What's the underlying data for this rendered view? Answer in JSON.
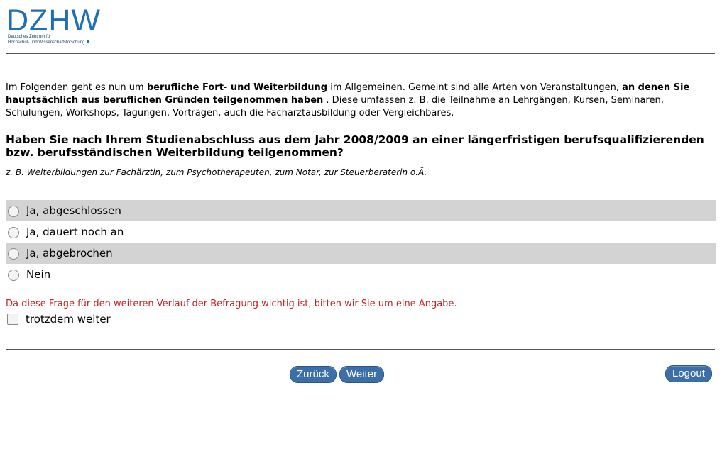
{
  "header": {
    "logo_text": "DZHW",
    "logo_subtitle_line1": "Deutsches Zentrum für",
    "logo_subtitle_line2": "Hochschul- und Wissenschaftsforschung"
  },
  "intro": {
    "p1": "Im Folgenden geht es nun um ",
    "b1": "berufliche Fort- und Weiterbildung",
    "p2": " im Allgemeinen. Gemeint sind alle Arten von Veranstaltungen, ",
    "b2": "an denen Sie hauptsächlich ",
    "u1": "aus beruflichen Gründen ",
    "b3": "teilgenommen haben",
    "p3": " . Diese umfassen z. B. die Teilnahme an Lehrgängen, Kursen, Seminaren, Schulungen, Workshops, Tagungen, Vorträgen, auch die Facharztausbildung oder Vergleichbares."
  },
  "question": {
    "text": "Haben Sie nach Ihrem Studienabschluss aus dem Jahr 2008/2009 an einer längerfristigen berufsqualifizierenden bzw. berufsständischen Weiterbildung teilgenommen?",
    "hint": "z. B. Weiterbildungen zur Fachärztin, zum Psychotherapeuten, zum Notar, zur Steuerberaterin o.Ä."
  },
  "options": [
    {
      "label": "Ja, abgeschlossen",
      "selected": false
    },
    {
      "label": "Ja, dauert noch an",
      "selected": false
    },
    {
      "label": "Ja, abgebrochen",
      "selected": false
    },
    {
      "label": "Nein",
      "selected": false
    }
  ],
  "validation": {
    "warning": "Da diese Frage für den weiteren Verlauf der Befragung wichtig ist, bitten wir Sie um eine Angabe.",
    "override_label": "trotzdem weiter",
    "override_checked": false
  },
  "nav": {
    "back_label": "Zurück",
    "next_label": "Weiter",
    "logout_label": "Logout"
  },
  "colors": {
    "brand": "#1f6fb6",
    "button": "#3c6ea7",
    "warning": "#cc1f1f",
    "row_shade": "#d3d3d3"
  }
}
